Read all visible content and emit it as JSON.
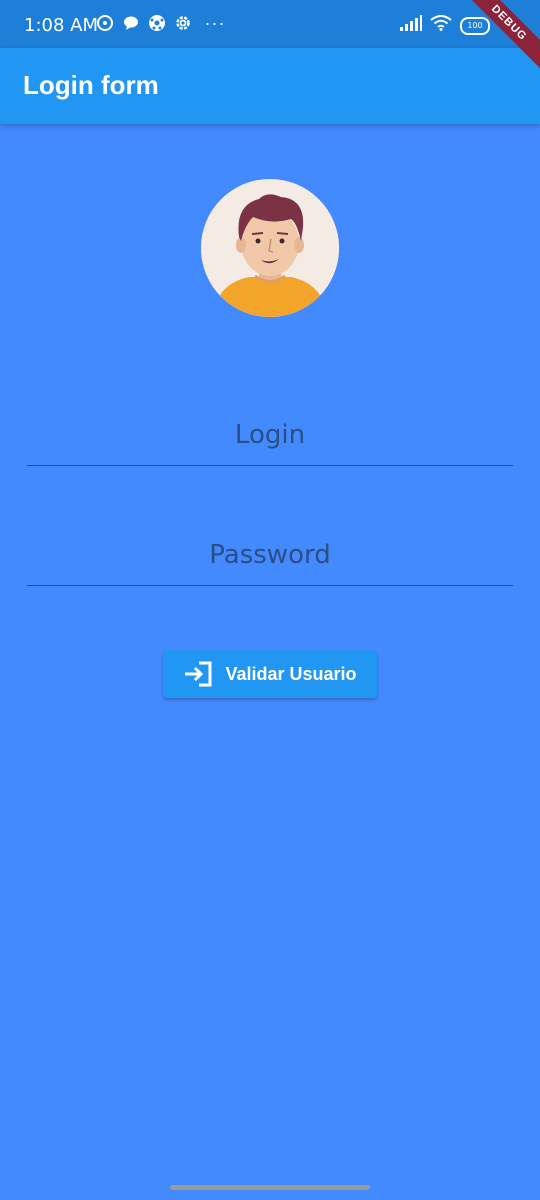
{
  "status_bar": {
    "time": "1:08 AM",
    "battery": "100",
    "icons_left": [
      "sync-icon",
      "chat-icon",
      "ball-icon",
      "settings-icon"
    ],
    "more": "···"
  },
  "app_bar": {
    "title": "Login form",
    "debug_label": "DEBUG"
  },
  "form": {
    "login_placeholder": "Login",
    "password_placeholder": "Password",
    "submit_label": "Validar Usuario"
  },
  "colors": {
    "background": "#448AFF",
    "app_bar": "#2196F3",
    "status_bar": "#1E7FD9",
    "button": "#2196F3",
    "field_text": "#2A4F86",
    "debug_banner": "#8B2438"
  }
}
